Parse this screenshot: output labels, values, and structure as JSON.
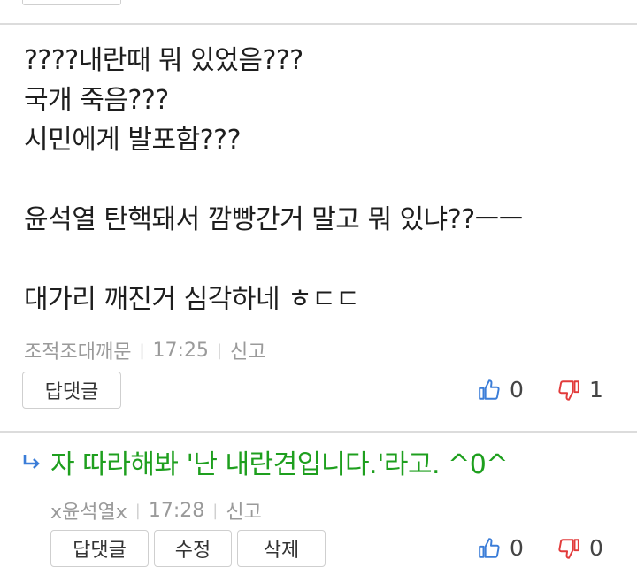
{
  "comments": [
    {
      "body": "????내란때 뭐 있었음???\n국개 죽음???\n시민에게 발포함???\n\n윤석열 탄핵돼서 깜빵간거 말고 뭐 있냐??ㅡㅡ\n\n대가리 깨진거 심각하네 ㅎㄷㄷ",
      "author": "조적조대깨문",
      "time": "17:25",
      "report_label": "신고",
      "reply_button": "답댓글",
      "likes": "0",
      "dislikes": "1"
    },
    {
      "body": "자 따라해봐 '난 내란견입니다.'라고. ^0^",
      "author": "x윤석열x",
      "time": "17:28",
      "report_label": "신고",
      "reply_button": "답댓글",
      "edit_button": "수정",
      "delete_button": "삭제",
      "likes": "0",
      "dislikes": "0"
    }
  ],
  "colors": {
    "reply_text": "#1e9f1e",
    "like_icon": "#3b7dd8",
    "dislike_icon": "#e23b3b"
  }
}
